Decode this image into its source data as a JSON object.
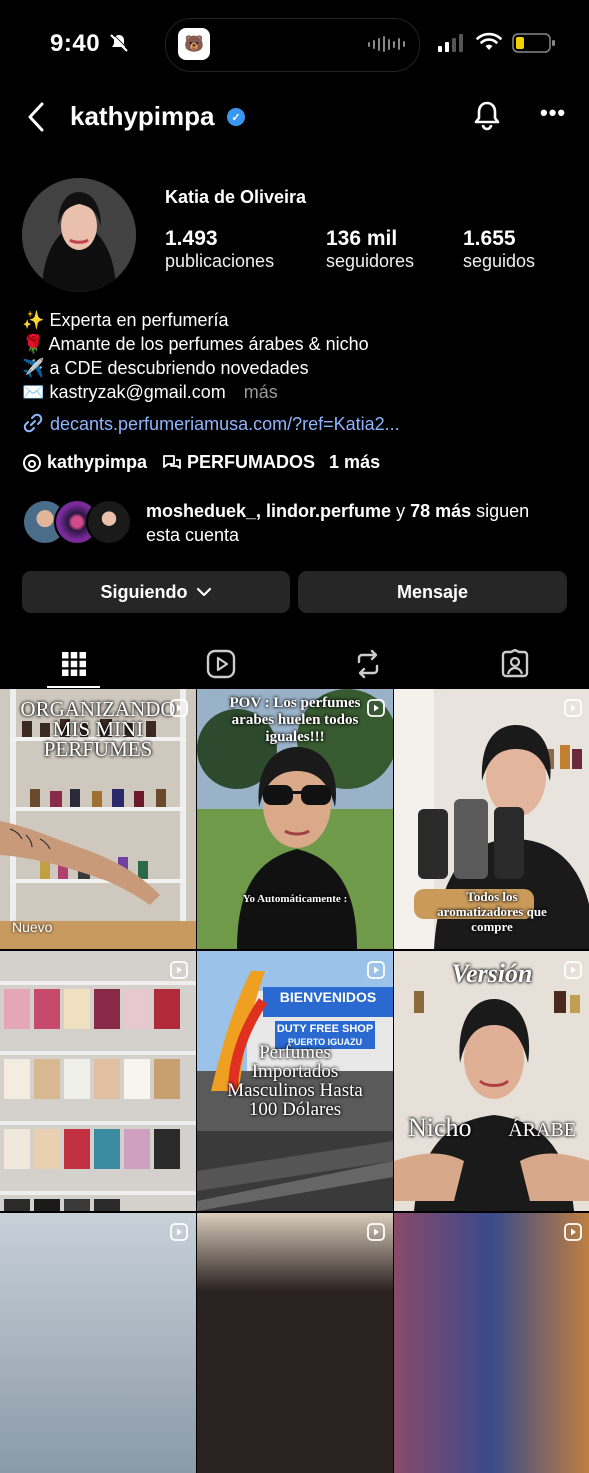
{
  "status_bar": {
    "time": "9:40"
  },
  "header": {
    "username": "kathypimpa",
    "more": "•••"
  },
  "profile": {
    "full_name": "Katia de Oliveira",
    "stats": [
      {
        "value": "1.493",
        "label": "publicaciones"
      },
      {
        "value": "136 mil",
        "label": "seguidores"
      },
      {
        "value": "1.655",
        "label": "seguidos"
      }
    ],
    "bio": [
      {
        "emoji": "✨",
        "text": "Experta en perfumería"
      },
      {
        "emoji": "🌹",
        "text": "Amante de los perfumes árabes & nicho"
      },
      {
        "emoji": "✈️",
        "text": "a CDE descubriendo novedades"
      },
      {
        "emoji": "✉️",
        "text": "kastryzak@gmail.com"
      }
    ],
    "bio_more": "más",
    "link": "decants.perfumeriamusa.com/?ref=Katia2...",
    "chips": {
      "threads": "kathypimpa",
      "community": "PERFUMADOS",
      "extra": "1 más"
    },
    "followed_by": {
      "names": "mosheduek_, lindor.perfume",
      "connector": " y ",
      "count": "78 más",
      "suffix": " siguen esta cuenta"
    }
  },
  "actions": {
    "following": "Siguiendo",
    "message": "Mensaje"
  },
  "posts": [
    {
      "overlay": "ORGANIZANDO MIS MINI PERFUMES",
      "badge": "Nuevo"
    },
    {
      "overlay": "POV : Los perfumes arabes huelen todos iguales!!!",
      "caption": "Yo Automáticamente :"
    },
    {
      "overlay": "Todos los aromatizadores que compre"
    },
    {
      "overlay": ""
    },
    {
      "sign1": "BIENVENIDOS",
      "sign2": "DUTY FREE SHOP",
      "sign3": "PUERTO IGUAZU",
      "overlay": "Perfumes Importados Masculinos Hasta 100 Dólares"
    },
    {
      "top": "Versión",
      "left": "Nicho",
      "right": "ÁRABE"
    }
  ]
}
